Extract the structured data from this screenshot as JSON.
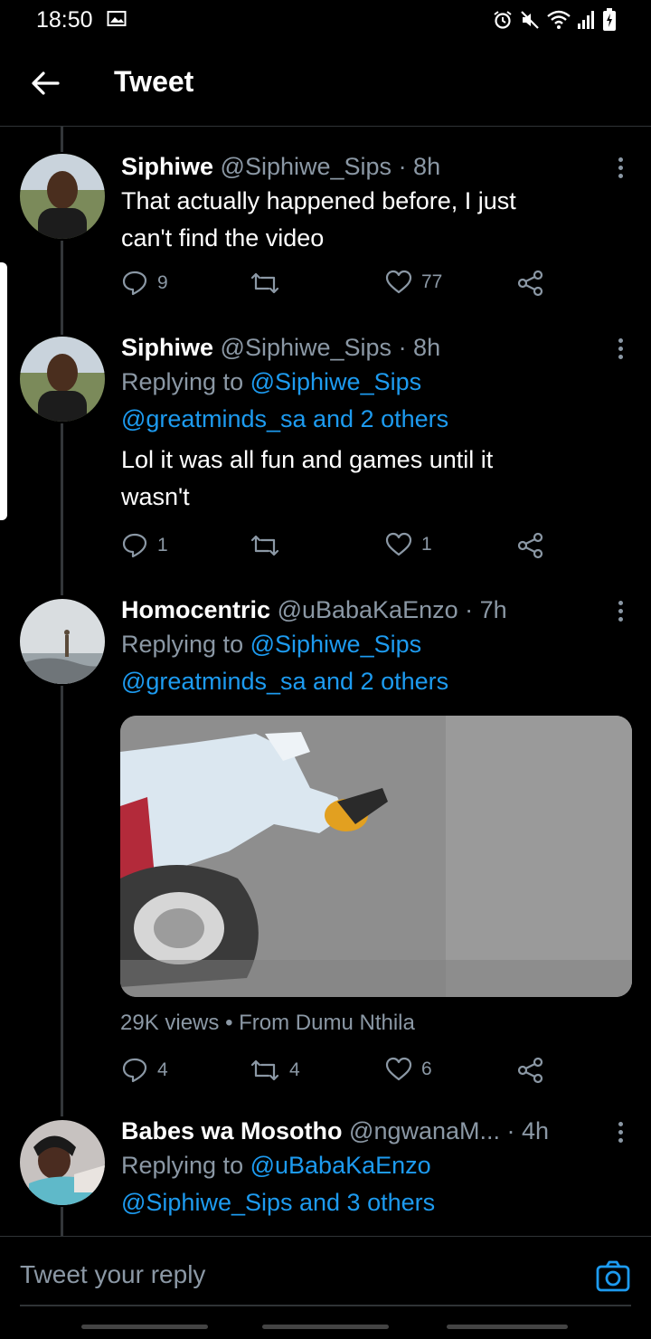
{
  "status": {
    "time": "18:50"
  },
  "header": {
    "title": "Tweet"
  },
  "tweets": [
    {
      "name": "Siphiwe",
      "handle": "@Siphiwe_Sips",
      "time": "· 8h",
      "text_lines": [
        "That actually happened before, I just",
        "can't find the video"
      ],
      "replies": "9",
      "retweets": "",
      "likes": "77"
    },
    {
      "name": "Siphiwe",
      "handle": "@Siphiwe_Sips",
      "time": "· 8h",
      "replying_prefix": "Replying to",
      "replying_user": "@Siphiwe_Sips",
      "replying_others": "@greatminds_sa and 2 others",
      "text_lines": [
        "Lol it was all fun and games until it",
        "wasn't"
      ],
      "replies": "1",
      "retweets": "",
      "likes": "1"
    },
    {
      "name": "Homocentric",
      "handle": "@uBabaKaEnzo",
      "time": "· 7h",
      "replying_prefix": "Replying to",
      "replying_user": "@Siphiwe_Sips",
      "replying_others": "@greatminds_sa and 2 others",
      "media_views": "29K views",
      "media_source": "From Dumu Nthila",
      "replies": "4",
      "retweets": "4",
      "likes": "6"
    },
    {
      "name": "Babes wa Mosotho",
      "handle": "@ngwanaM...",
      "time": "· 4h",
      "replying_prefix": "Replying to",
      "replying_user": "@uBabaKaEnzo",
      "replying_others": "@Siphiwe_Sips and 3 others"
    }
  ],
  "composer": {
    "placeholder": "Tweet your reply"
  },
  "colors": {
    "accent": "#1d9bf0",
    "background": "#000000",
    "muted": "#8b98a5"
  },
  "icons": [
    "back-arrow-icon",
    "reply-icon",
    "retweet-icon",
    "like-icon",
    "share-icon",
    "more-icon",
    "camera-icon"
  ]
}
